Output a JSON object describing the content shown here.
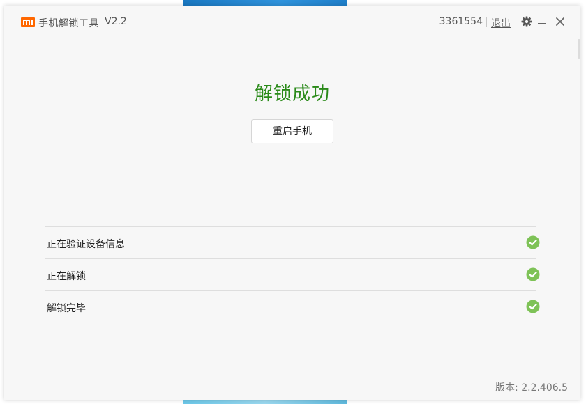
{
  "titlebar": {
    "app_name": "手机解锁工具",
    "version": "V2.2",
    "account_id": "3361554",
    "logout_label": "退出"
  },
  "main": {
    "success_title": "解锁成功",
    "restart_button": "重启手机"
  },
  "steps": [
    {
      "label": "正在验证设备信息",
      "status": "done"
    },
    {
      "label": "正在解锁",
      "status": "done"
    },
    {
      "label": "解锁完毕",
      "status": "done"
    }
  ],
  "footer": {
    "build_version": "版本: 2.2.406.5"
  },
  "colors": {
    "brand": "#ff6700",
    "success_text": "#2a8a19",
    "check_green": "#7ec257"
  },
  "icons": {
    "logo": "mi-logo-icon",
    "settings": "gear-icon",
    "minimize": "minimize-icon",
    "close": "close-icon",
    "step_status": "check-circle-icon"
  }
}
